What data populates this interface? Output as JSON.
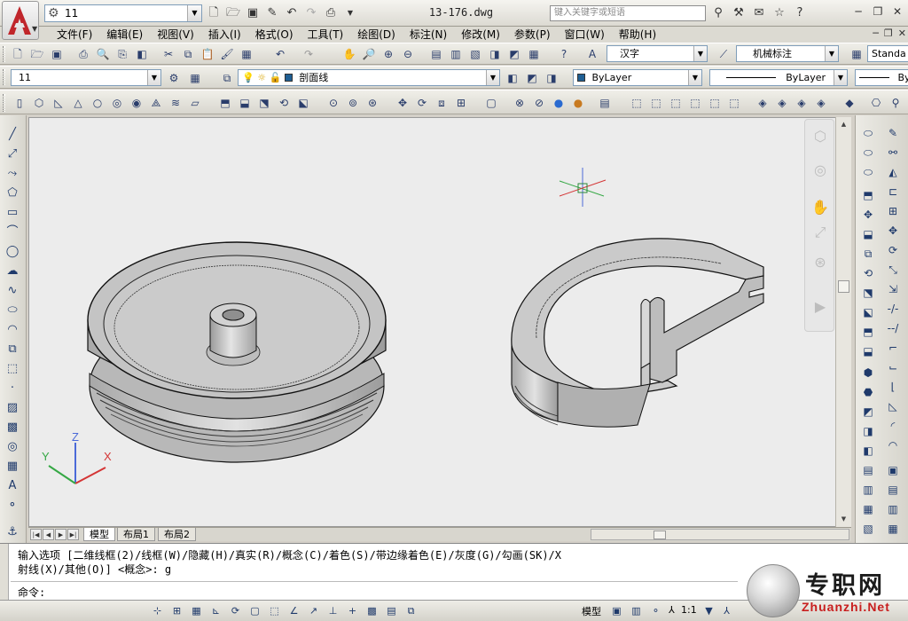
{
  "window": {
    "workspace": "11",
    "doc_title": "13-176.dwg",
    "search_placeholder": "键入关键字或短语"
  },
  "menu": [
    "文件(F)",
    "编辑(E)",
    "视图(V)",
    "插入(I)",
    "格式(O)",
    "工具(T)",
    "绘图(D)",
    "标注(N)",
    "修改(M)",
    "参数(P)",
    "窗口(W)",
    "帮助(H)"
  ],
  "toolbar": {
    "text_style": "汉字",
    "dim_style": "机械标注",
    "table_style": "Standa",
    "layer": "11",
    "layer_name": "剖面线",
    "color": "ByLayer",
    "linetype": "ByLayer",
    "lineweight": "By"
  },
  "tabs": {
    "model": "模型",
    "layout1": "布局1",
    "layout2": "布局2"
  },
  "command": {
    "line1": "输入选项 [二维线框(2)/线框(W)/隐藏(H)/真实(R)/概念(C)/着色(S)/带边缘着色(E)/灰度(G)/勾画(SK)/X",
    "line2": "射线(X)/其他(O)] <概念>: g",
    "prompt": "命令:"
  },
  "status": {
    "model": "模型",
    "scale": "1:1"
  },
  "ucs": {
    "x": "X",
    "y": "Y",
    "z": "Z"
  },
  "watermark": {
    "cn": "专职网",
    "en": "Zhuanzhi.Net"
  },
  "colors": {
    "accent": "#c81e1e",
    "layer_swatch": "#1f5f94"
  }
}
